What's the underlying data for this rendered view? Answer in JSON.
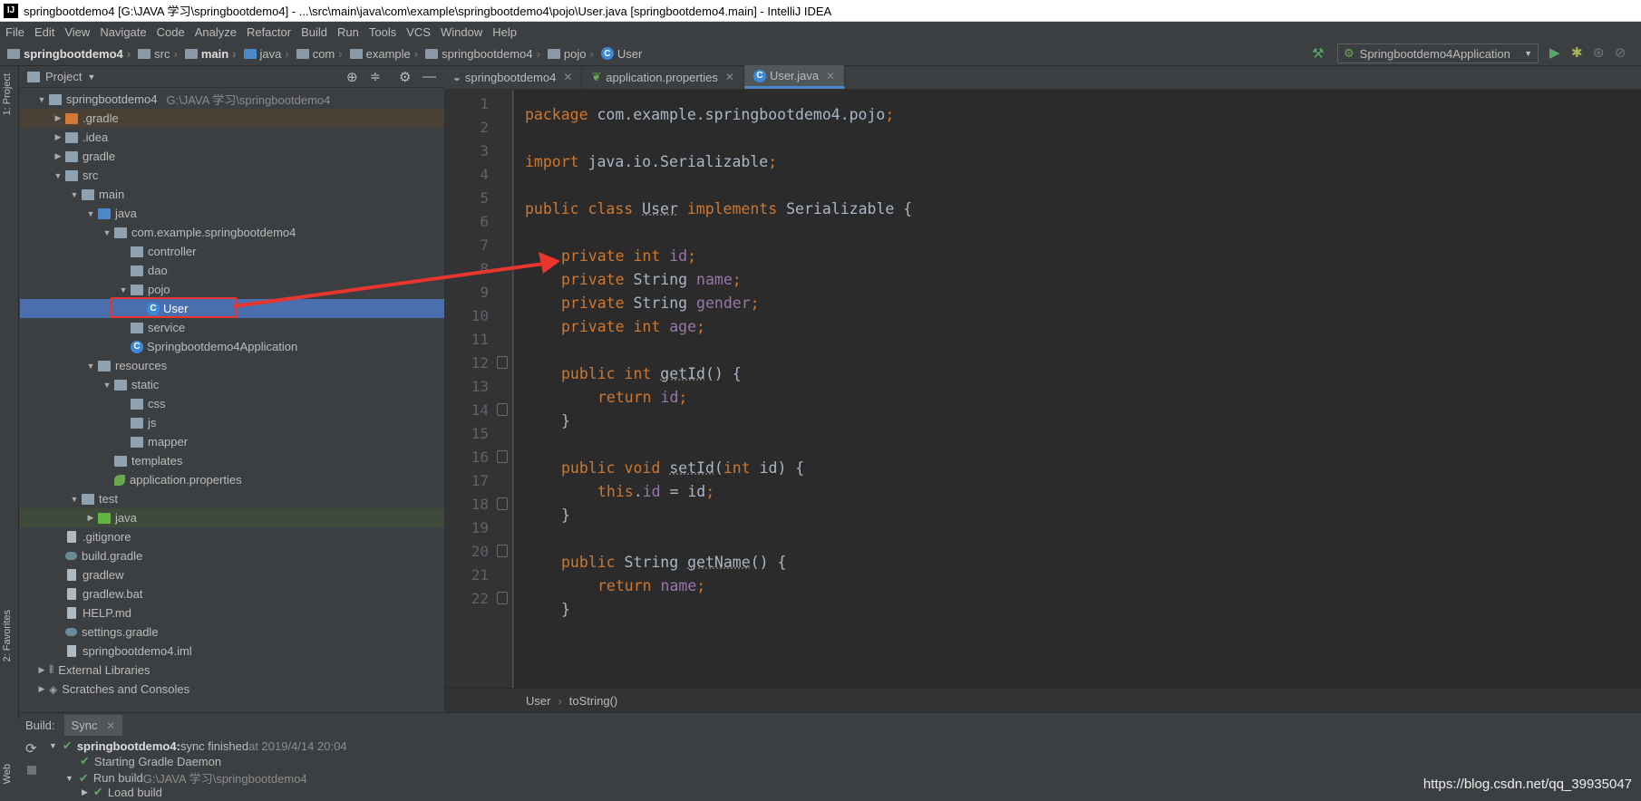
{
  "window": {
    "title": "springbootdemo4 [G:\\JAVA 学习\\springbootdemo4] - ...\\src\\main\\java\\com\\example\\springbootdemo4\\pojo\\User.java [springbootdemo4.main] - IntelliJ IDEA",
    "app_icon": "IJ"
  },
  "menu": [
    "File",
    "Edit",
    "View",
    "Navigate",
    "Code",
    "Analyze",
    "Refactor",
    "Build",
    "Run",
    "Tools",
    "VCS",
    "Window",
    "Help"
  ],
  "breadcrumbs": [
    "springbootdemo4",
    "src",
    "main",
    "java",
    "com",
    "example",
    "springbootdemo4",
    "pojo",
    "User"
  ],
  "run_config": {
    "label": "Springbootdemo4Application",
    "icons": [
      "hammer-icon",
      "run-icon",
      "debug-icon",
      "coverage-icon",
      "stop-icon"
    ]
  },
  "left_strip": {
    "project_tab": "1: Project",
    "favorites_tab": "2: Favorites",
    "web_tab": "Web"
  },
  "project_panel": {
    "header": "Project",
    "tree": [
      {
        "label": "springbootdemo4",
        "hint": "G:\\JAVA 学习\\springbootdemo4",
        "arrow": "▼",
        "icon": "folder"
      },
      {
        "label": ".gradle",
        "arrow": "▶",
        "icon": "folder-orange"
      },
      {
        "label": ".idea",
        "arrow": "▶",
        "icon": "folder"
      },
      {
        "label": "gradle",
        "arrow": "▶",
        "icon": "folder"
      },
      {
        "label": "src",
        "arrow": "▼",
        "icon": "folder"
      },
      {
        "label": "main",
        "arrow": "▼",
        "icon": "folder"
      },
      {
        "label": "java",
        "arrow": "▼",
        "icon": "folder-blue"
      },
      {
        "label": "com.example.springbootdemo4",
        "arrow": "▼",
        "icon": "folder"
      },
      {
        "label": "controller",
        "arrow": "",
        "icon": "folder"
      },
      {
        "label": "dao",
        "arrow": "",
        "icon": "folder"
      },
      {
        "label": "pojo",
        "arrow": "▼",
        "icon": "folder"
      },
      {
        "label": "User",
        "arrow": "",
        "icon": "class"
      },
      {
        "label": "service",
        "arrow": "",
        "icon": "folder"
      },
      {
        "label": "Springbootdemo4Application",
        "arrow": "",
        "icon": "class"
      },
      {
        "label": "resources",
        "arrow": "▼",
        "icon": "folder"
      },
      {
        "label": "static",
        "arrow": "▼",
        "icon": "folder"
      },
      {
        "label": "css",
        "arrow": "",
        "icon": "folder"
      },
      {
        "label": "js",
        "arrow": "",
        "icon": "folder"
      },
      {
        "label": "mapper",
        "arrow": "",
        "icon": "folder"
      },
      {
        "label": "templates",
        "arrow": "",
        "icon": "folder"
      },
      {
        "label": "application.properties",
        "arrow": "",
        "icon": "leaf"
      },
      {
        "label": "test",
        "arrow": "▼",
        "icon": "folder"
      },
      {
        "label": "java",
        "arrow": "▶",
        "icon": "folder-green"
      },
      {
        "label": ".gitignore",
        "arrow": "",
        "icon": "file"
      },
      {
        "label": "build.gradle",
        "arrow": "",
        "icon": "gradle"
      },
      {
        "label": "gradlew",
        "arrow": "",
        "icon": "file"
      },
      {
        "label": "gradlew.bat",
        "arrow": "",
        "icon": "file"
      },
      {
        "label": "HELP.md",
        "arrow": "",
        "icon": "file"
      },
      {
        "label": "settings.gradle",
        "arrow": "",
        "icon": "gradle"
      },
      {
        "label": "springbootdemo4.iml",
        "arrow": "",
        "icon": "file"
      },
      {
        "label": "External Libraries",
        "arrow": "▶",
        "icon": "library"
      },
      {
        "label": "Scratches and Consoles",
        "arrow": "▶",
        "icon": "scratch"
      }
    ]
  },
  "editor": {
    "tabs": [
      {
        "label": "springbootdemo4",
        "active": false
      },
      {
        "label": "application.properties",
        "active": false
      },
      {
        "label": "User.java",
        "active": true
      }
    ],
    "line_numbers": [
      "1",
      "2",
      "3",
      "4",
      "5",
      "6",
      "7",
      "8",
      "9",
      "10",
      "11",
      "12",
      "13",
      "14",
      "15",
      "16",
      "17",
      "18",
      "19",
      "20",
      "21",
      "22"
    ],
    "code": {
      "l1_kw": "package",
      "l1_rest": " com.example.springbootdemo4.pojo",
      "l1_semi": ";",
      "l3_kw": "import",
      "l3_rest": " java.io.Serializable",
      "l3_semi": ";",
      "l5_kw1": "public class ",
      "l5_name": "User",
      "l5_kw2": " implements ",
      "l5_rest": "Serializable {",
      "l7_kw": "private int ",
      "l7_f": "id",
      "l7_semi": ";",
      "l8_kw": "private ",
      "l8_t": "String ",
      "l8_f": "name",
      "l8_semi": ";",
      "l9_kw": "private ",
      "l9_t": "String ",
      "l9_f": "gender",
      "l9_semi": ";",
      "l10_kw": "private int ",
      "l10_f": "age",
      "l10_semi": ";",
      "l12_kw": "public int ",
      "l12_m": "getId",
      "l12_rest": "() {",
      "l13_kw": "return ",
      "l13_f": "id",
      "l13_semi": ";",
      "l14": "}",
      "l16_kw": "public void ",
      "l16_m": "setId",
      "l16_p1": "(",
      "l16_pk": "int",
      "l16_rest": " id) {",
      "l17_kw": "this",
      "l17_dot": ".",
      "l17_f": "id",
      "l17_rest": " = id",
      "l17_semi": ";",
      "l18": "}",
      "l20_kw": "public ",
      "l20_t": "String ",
      "l20_m": "getName",
      "l20_rest": "() {",
      "l21_kw": "return ",
      "l21_f": "name",
      "l21_semi": ";",
      "l22": "}"
    },
    "crumb": [
      "User",
      "toString()"
    ]
  },
  "build": {
    "label": "Build:",
    "tab": "Sync",
    "rows": [
      {
        "bold": "springbootdemo4:",
        "text": " sync finished",
        "hint": " at 2019/4/14 20:04"
      },
      {
        "text": "Starting Gradle Daemon"
      },
      {
        "text": "Run build",
        "hint": " G:\\JAVA 学习\\springbootdemo4"
      },
      {
        "text": "Load build"
      }
    ]
  },
  "watermark": "https://blog.csdn.net/qq_39935047",
  "colors": {
    "bg": "#3c3f41",
    "editor_bg": "#2b2b2b",
    "keyword": "#cc7832",
    "field": "#9876aa",
    "selection": "#4b6eaf",
    "annotation_red": "#e8352e"
  }
}
